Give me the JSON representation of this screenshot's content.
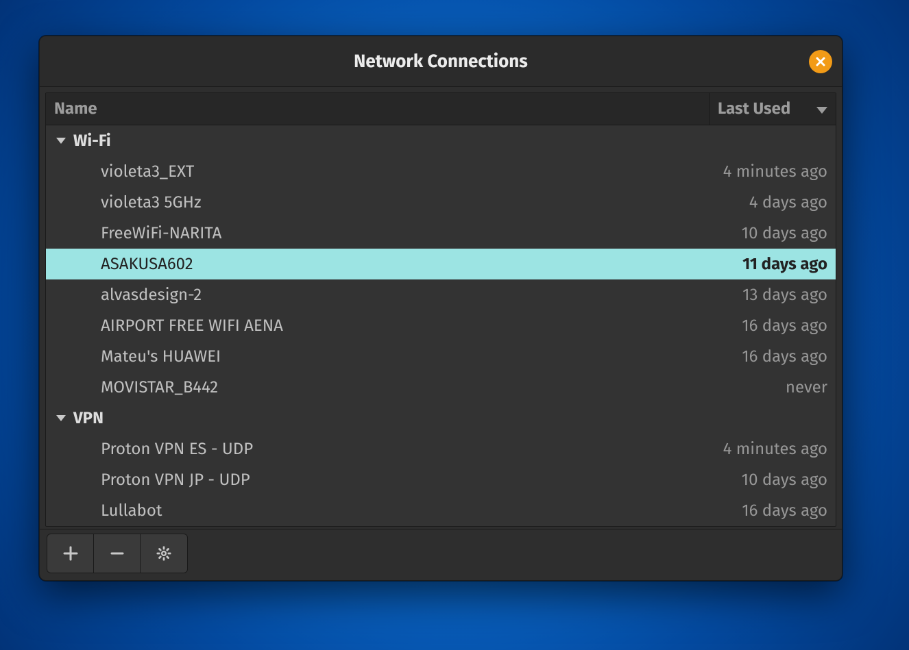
{
  "window": {
    "title": "Network Connections"
  },
  "columns": {
    "name": "Name",
    "last": "Last Used"
  },
  "groups": [
    {
      "label": "Wi-Fi",
      "items": [
        {
          "name": "violeta3_EXT",
          "last": "4 minutes ago",
          "selected": false
        },
        {
          "name": "violeta3 5GHz",
          "last": "4 days ago",
          "selected": false
        },
        {
          "name": "FreeWiFi-NARITA",
          "last": "10 days ago",
          "selected": false
        },
        {
          "name": "ASAKUSA602",
          "last": "11 days ago",
          "selected": true
        },
        {
          "name": "alvasdesign-2",
          "last": "13 days ago",
          "selected": false
        },
        {
          "name": "AIRPORT FREE WIFI AENA",
          "last": "16 days ago",
          "selected": false
        },
        {
          "name": "Mateu's HUAWEI",
          "last": "16 days ago",
          "selected": false
        },
        {
          "name": "MOVISTAR_B442",
          "last": "never",
          "selected": false
        }
      ]
    },
    {
      "label": "VPN",
      "items": [
        {
          "name": "Proton VPN ES - UDP",
          "last": "4 minutes ago",
          "selected": false
        },
        {
          "name": "Proton VPN JP - UDP",
          "last": "10 days ago",
          "selected": false
        },
        {
          "name": "Lullabot",
          "last": "16 days ago",
          "selected": false
        }
      ]
    }
  ],
  "toolbar": {
    "add": "Add",
    "remove": "Remove",
    "settings": "Settings"
  },
  "colors": {
    "selection": "#9ce4e3",
    "close_button": "#f29b17"
  }
}
